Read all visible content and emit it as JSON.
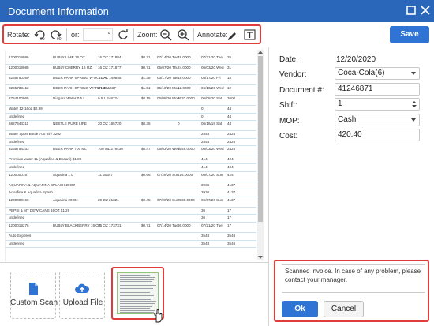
{
  "window": {
    "title": "Document Information"
  },
  "toolbar": {
    "rotate_label": "Rotate:",
    "rotate_left_sub": "90",
    "rotate_right_sub": "90",
    "or_label": "or:",
    "degree_value": "°",
    "zoom_label": "Zoom:",
    "annotate_label": "Annotate:"
  },
  "save_label": "Save",
  "document_rows": [
    {
      "c1": "1200019086",
      "c2": "BUBLY LIME 16 OZ",
      "c3": "16 OZ 171884",
      "c4": "$0.71",
      "c5": "07/14/20 Tue",
      "c6": "48.0000",
      "c7": "07/21/20 Tue",
      "c8": "25"
    },
    {
      "c1": "1200019085",
      "c2": "BUBLY CHERRY 16 OZ",
      "c3": "16 OZ 171877",
      "c4": "$0.71",
      "c5": "05/07/20 Thu",
      "c6": "24.0000",
      "c7": "06/03/20 Wed",
      "c8": "31"
    },
    {
      "c1": "8265750360",
      "c2": "DEER PARK SPRING WTR 1GAL",
      "c3": "1 GAL 149855",
      "c4": "$1.38",
      "c5": "03/17/20 Tue",
      "c6": "18.0000",
      "c7": "04/17/20 Fri",
      "c8": "18"
    },
    {
      "c1": "8265733412",
      "c2": "DEER PARK SPRING WATER 3 L",
      "c3": "3 L 851667",
      "c4": "$1.51",
      "c5": "05/18/20 Mon",
      "c6": "12.0000",
      "c7": "06/10/20 Wed",
      "c8": "12"
    },
    {
      "c1": "2754100065",
      "c2": "Niagara Water 0.5 L",
      "c3": "0.5 L 248724",
      "c4": "$0.15",
      "c5": "06/08/20 Mon",
      "c6": "3632.0000",
      "c7": "06/08/20 Sat",
      "c8": "3600"
    },
    {
      "c1": "Water 12-16oz $0.99",
      "c2": "",
      "c3": "",
      "c4": "",
      "c5": "",
      "c6": "",
      "c7": "0",
      "c8": "44"
    },
    {
      "c1": "undefined",
      "c2": "",
      "c3": "",
      "c4": "",
      "c5": "",
      "c6": "",
      "c7": "0",
      "c8": "44"
    },
    {
      "c1": "6827444311",
      "c2": "NESTLE PURE LIFE",
      "c3": "20 OZ 165720",
      "c4": "$0.35",
      "c5": "",
      "c6": "0",
      "c7": "06/16/18 Sat",
      "c8": "44"
    },
    {
      "c1": "Water Sport Bottle 700 ml / 32oz",
      "c2": "",
      "c3": "",
      "c4": "",
      "c5": "",
      "c6": "",
      "c7": "2548",
      "c8": "2425"
    },
    {
      "c1": "undefined",
      "c2": "",
      "c3": "",
      "c4": "",
      "c5": "",
      "c6": "",
      "c7": "2548",
      "c8": "2425"
    },
    {
      "c1": "8265754333",
      "c2": "DEER PARK 700 ML",
      "c3": "700 ML 279430",
      "c4": "$0.47",
      "c5": "06/03/20 Wed",
      "c6": "2548.0000",
      "c7": "06/03/20 Wed",
      "c8": "2425"
    },
    {
      "c1": "Premium water 1L (Aquafina & Dasani) $1.89",
      "c2": "",
      "c3": "",
      "c4": "",
      "c5": "",
      "c6": "",
      "c7": "414",
      "c8": "424"
    },
    {
      "c1": "undefined",
      "c2": "",
      "c3": "",
      "c4": "",
      "c5": "",
      "c6": "",
      "c7": "414",
      "c8": "424"
    },
    {
      "c1": "1200000157",
      "c2": "Aquafina 1 L",
      "c3": "1L 30347",
      "c4": "$0.66",
      "c5": "07/26/20 Sun",
      "c6": "414.0000",
      "c7": "06/07/20 Sun",
      "c8": "424"
    },
    {
      "c1": "AQUAFINA & AQUAFINA SPLASH 20OZ",
      "c2": "",
      "c3": "",
      "c4": "",
      "c5": "",
      "c6": "",
      "c7": "3936",
      "c8": "4137"
    },
    {
      "c1": "Aquafina & Aquafina Spash",
      "c2": "",
      "c3": "",
      "c4": "",
      "c5": "",
      "c6": "",
      "c7": "3936",
      "c8": "4137"
    },
    {
      "c1": "1200000159",
      "c2": "Aquafina 20 Oz",
      "c3": "20 OZ 21321",
      "c4": "$0.45",
      "c5": "07/26/20 Sun",
      "c6": "3936.0000",
      "c7": "06/07/20 Sun",
      "c8": "4137"
    },
    {
      "c1": "PEPSI & MT DEW CANS 16OZ $1.29",
      "c2": "",
      "c3": "",
      "c4": "",
      "c5": "",
      "c6": "",
      "c7": "36",
      "c8": "17"
    },
    {
      "c1": "undefined",
      "c2": "",
      "c3": "",
      "c4": "",
      "c5": "",
      "c6": "",
      "c7": "36",
      "c8": "17"
    },
    {
      "c1": "1200019276",
      "c2": "BUBLY BLACKBERRY 16 OZ",
      "c3": "16 OZ 173731",
      "c4": "$0.71",
      "c5": "07/14/20 Tue",
      "c6": "36.0000",
      "c7": "07/21/20 Tue",
      "c8": "17"
    },
    {
      "c1": "Auto Supplies",
      "c2": "",
      "c3": "",
      "c4": "",
      "c5": "",
      "c6": "",
      "c7": "3548",
      "c8": "3546"
    },
    {
      "c1": "undefined",
      "c2": "",
      "c3": "",
      "c4": "",
      "c5": "",
      "c6": "",
      "c7": "3548",
      "c8": "3546"
    }
  ],
  "upload": {
    "custom_scan_label": "Custom Scan",
    "upload_file_label": "Upload File"
  },
  "form": {
    "date_label": "Date:",
    "date_value": "12/20/2020",
    "vendor_label": "Vendor:",
    "vendor_value": "Coca-Cola(6)",
    "document_label": "Document #:",
    "document_value": "41246871",
    "shift_label": "Shift:",
    "shift_value": "1",
    "mop_label": "MOP:",
    "mop_value": "Cash",
    "cost_label": "Cost:",
    "cost_value": "420.40"
  },
  "comment": {
    "text": "Scanned invoice. In case of any problem, please contact your manager."
  },
  "buttons": {
    "ok_label": "Ok",
    "cancel_label": "Cancel"
  },
  "colors": {
    "accent": "#2a67bb",
    "button_blue": "#2f74d4",
    "highlight_red": "#e03c3c"
  }
}
